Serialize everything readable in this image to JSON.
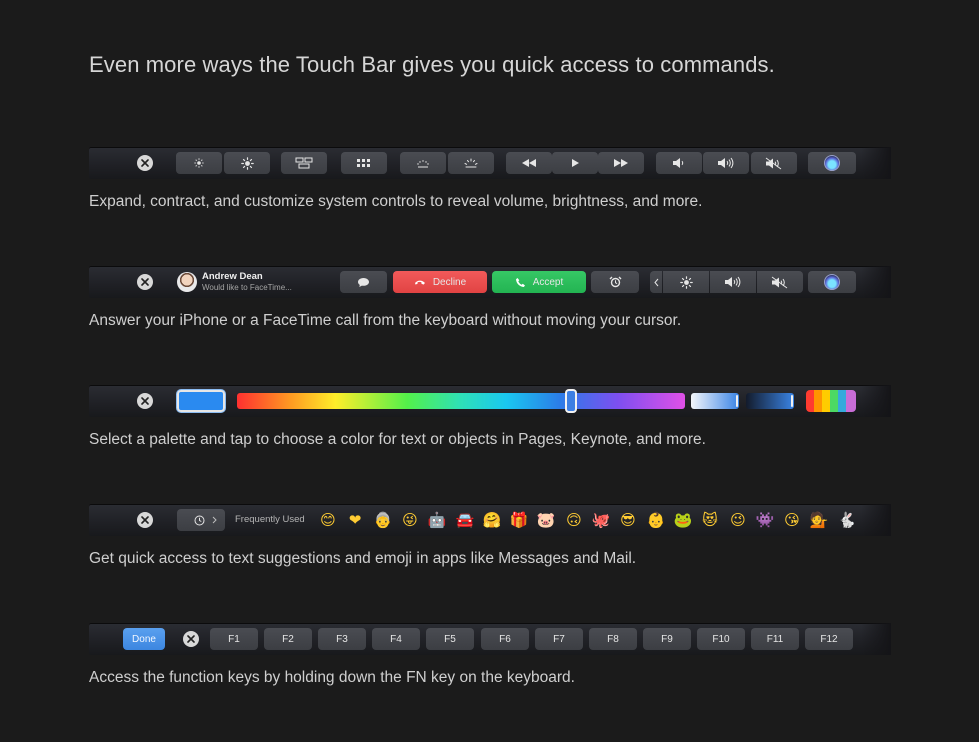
{
  "headline": "Even more ways the Touch Bar gives you quick access to commands.",
  "captions": {
    "system": "Expand, contract, and customize system controls to reveal volume, brightness, and more.",
    "call": "Answer your iPhone or a FaceTime call from the keyboard without moving your cursor.",
    "color": "Select a palette and tap to choose a color for text or objects in Pages, Keynote, and more.",
    "emoji": "Get quick access to text suggestions and emoji in apps like Messages and Mail.",
    "fn": "Access the function keys by holding down the FN key on the keyboard."
  },
  "call": {
    "caller_name": "Andrew Dean",
    "caller_subtitle": "Would like to FaceTime...",
    "decline_label": "Decline",
    "accept_label": "Accept"
  },
  "emoji_bar": {
    "frequently_used_label": "Frequently Used",
    "emojis": [
      "😊",
      "❤",
      "👵",
      "😜",
      "🤖",
      "🚘",
      "🤗",
      "🎁",
      "🐷",
      "🙃",
      "🐙",
      "😎",
      "👶",
      "🐸",
      "😻",
      "😉",
      "👾",
      "😘",
      "💁",
      "🐇"
    ]
  },
  "fn_bar": {
    "done_label": "Done",
    "keys": [
      "F1",
      "F2",
      "F3",
      "F4",
      "F5",
      "F6",
      "F7",
      "F8",
      "F9",
      "F10",
      "F11",
      "F12"
    ]
  },
  "colors": {
    "bar_bg": "#202126",
    "key_bg": "#404247",
    "decline": "#e94b4b",
    "accept": "#2bbd5a",
    "done": "#4a92e8",
    "swatch": "#2a8af0"
  },
  "icons": {
    "close": "close-icon",
    "brightness_down": "brightness-down-icon",
    "brightness_up": "brightness-up-icon",
    "mission_control": "mission-control-icon",
    "launchpad": "launchpad-icon",
    "keyboard_light_down": "keyboard-backlight-down-icon",
    "keyboard_light_up": "keyboard-backlight-up-icon",
    "rewind": "rewind-icon",
    "play": "play-icon",
    "fast_forward": "fast-forward-icon",
    "volume_down": "volume-down-icon",
    "volume_up": "volume-up-icon",
    "mute": "mute-icon",
    "siri": "siri-icon",
    "message": "message-icon",
    "phone": "phone-icon",
    "alarm": "alarm-icon",
    "chevron_left": "chevron-left-icon",
    "clock": "clock-icon",
    "chevron_right": "chevron-right-icon"
  }
}
